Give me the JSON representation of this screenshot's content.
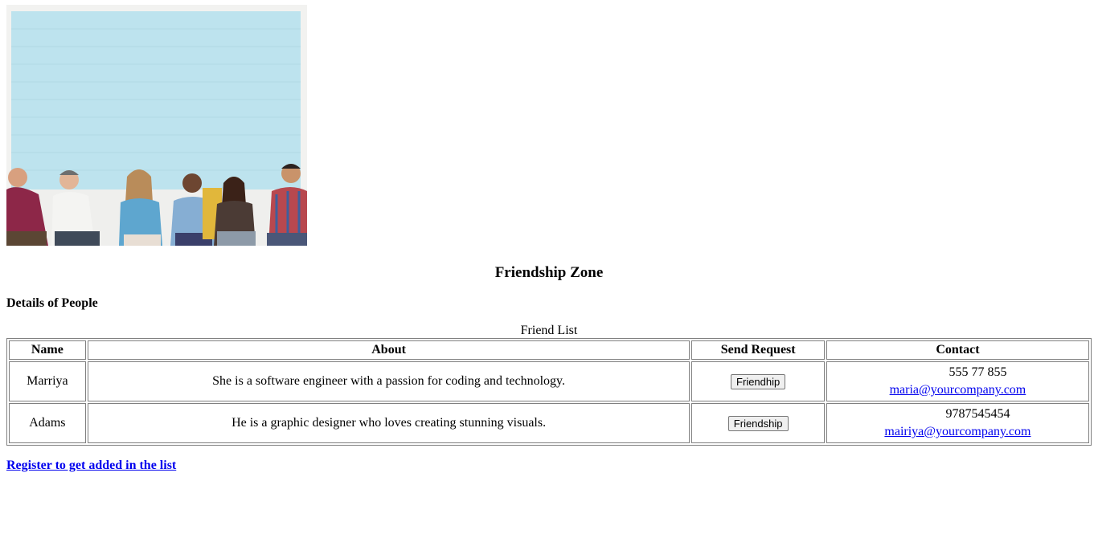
{
  "hero": {
    "image": "group-of-friends-sitting-photo",
    "colors": {
      "wall": "#bde3ee",
      "floor": "#f1f1ef"
    }
  },
  "page": {
    "title": "Friendship Zone",
    "subtitle": "Details of People",
    "register_link": "Register to get added in the list"
  },
  "table": {
    "caption": "Friend List",
    "headers": [
      "Name",
      "About",
      "Send Request",
      "Contact"
    ],
    "rows": [
      {
        "name": "Marriya",
        "about": "She is a software engineer with a passion for coding and technology.",
        "button": "Friendhip",
        "phone": "555 77 855",
        "email": "maria@yourcompany.com"
      },
      {
        "name": "Adams",
        "about": "He is a graphic designer who loves creating stunning visuals.",
        "button": "Friendship",
        "phone": "9787545454",
        "email": "mairiya@yourcompany.com"
      }
    ]
  },
  "colors": {
    "link": "#0000ee",
    "border": "#808080"
  }
}
